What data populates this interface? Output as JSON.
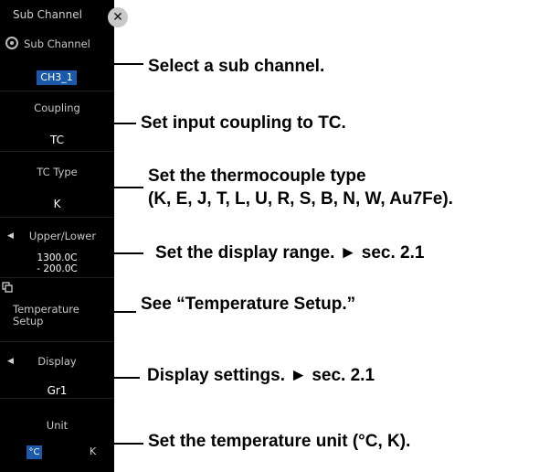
{
  "panel": {
    "title": "Sub Channel",
    "sub_channel": {
      "label": "Sub Channel",
      "value": "CH3_1"
    },
    "coupling": {
      "label": "Coupling",
      "value": "TC"
    },
    "tc_type": {
      "label": "TC Type",
      "value": "K"
    },
    "upper_lower": {
      "label": "Upper/Lower",
      "upper": "1300.0C",
      "lower": "- 200.0C"
    },
    "temperature_setup": {
      "label_line1": "Temperature",
      "label_line2": "Setup"
    },
    "display": {
      "label": "Display",
      "value": "Gr1"
    },
    "unit": {
      "label": "Unit",
      "options": [
        "°C",
        "K"
      ],
      "selected": "°C"
    }
  },
  "annotations": {
    "sub_channel": "Select a sub channel.",
    "coupling": "Set input coupling to TC.",
    "tc_type_line1": "Set the thermocouple type",
    "tc_type_line2": "(K, E, J, T, L, U, R, S, B, N, W, Au7Fe).",
    "upper_lower": "Set the display range. ► sec. 2.1",
    "temperature_setup": "See “Temperature Setup.”",
    "display": "Display settings. ► sec. 2.1",
    "unit": "Set the temperature unit (°C, K)."
  }
}
